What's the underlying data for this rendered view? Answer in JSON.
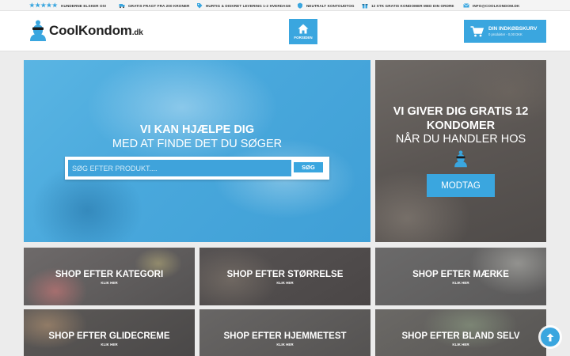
{
  "topbar": {
    "rating_stars": "★★★★★",
    "items": [
      "KUNDERNE ELSKER OS!",
      "GRATIS FRAGT FRA 200 KRONER",
      "HURTIG & DISKRET LEVERING 1-2 HVERDAGE",
      "NEUTRALT KONTOUDTOG",
      "12 STK GRATIS KONDOMER MED DIN ORDRE",
      "INFO@COOLKONDOM.DK"
    ]
  },
  "header": {
    "logo_main": "CoolKondom",
    "logo_suffix": ".dk",
    "home_label": "FORSIDEN",
    "cart_title": "DIN INDKØBSKURV",
    "cart_sub": "0 produkter - 0,00 DKK"
  },
  "hero": {
    "title_line1": "VI KAN HJÆLPE DIG",
    "title_line2": "MED AT FINDE DET DU SØGER",
    "search_placeholder": "SØG EFTER PRODUKT....",
    "search_button": "SØG"
  },
  "promo": {
    "line1": "VI GIVER DIG GRATIS 12 KONDOMER",
    "line2": "NÅR DU HANDLER HOS",
    "button": "MODTAG"
  },
  "tiles": [
    {
      "title": "SHOP EFTER KATEGORI",
      "sub": "KLIK HER"
    },
    {
      "title": "SHOP EFTER STØRRELSE",
      "sub": "KLIK HER"
    },
    {
      "title": "SHOP EFTER MÆRKE",
      "sub": "KLIK HER"
    },
    {
      "title": "SHOP EFTER GLIDECREME",
      "sub": "KLIK HER"
    },
    {
      "title": "SHOP EFTER HJEMMETEST",
      "sub": "KLIK HER"
    },
    {
      "title": "SHOP EFTER BLAND SELV",
      "sub": "KLIK HER"
    }
  ],
  "colors": {
    "accent": "#3aa6df",
    "tile_overlay": "#555252",
    "text_dark": "#222222"
  },
  "icons": [
    "star-icon",
    "truck-icon",
    "tag-icon",
    "shield-icon",
    "gift-icon",
    "mail-icon",
    "home-icon",
    "cart-icon",
    "mascot-icon",
    "arrow-up-icon"
  ]
}
